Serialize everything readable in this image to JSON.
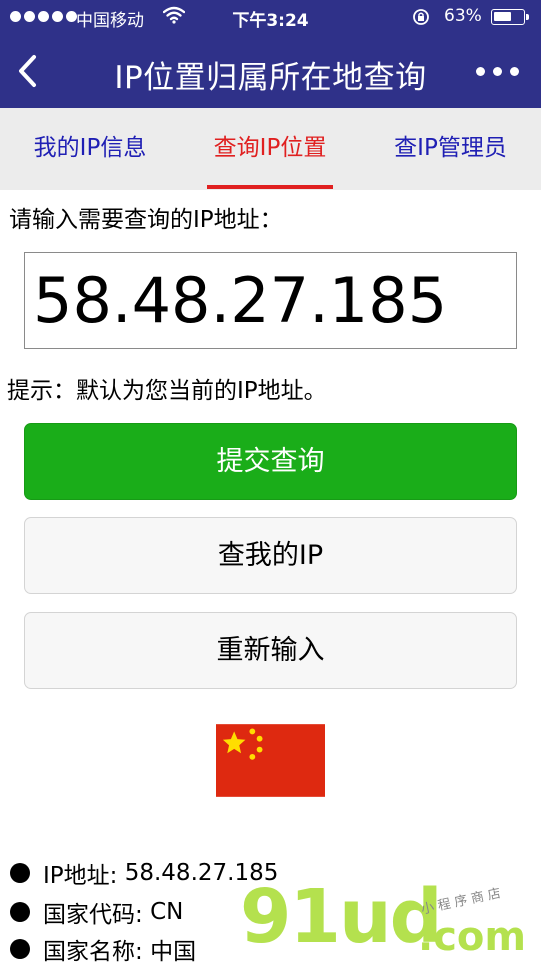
{
  "status_bar": {
    "carrier": "中国移动",
    "time": "下午3:24",
    "battery_text": "63%",
    "battery_level": 0.63
  },
  "header": {
    "title": "IP位置归属所在地查询",
    "icons": {
      "back": "chevron-left-icon",
      "more": "more-dots-icon"
    },
    "bg_color": "#2f3189"
  },
  "tabs": [
    {
      "label": "我的IP信息",
      "active": false
    },
    {
      "label": "查询IP位置",
      "active": true
    },
    {
      "label": "查IP管理员",
      "active": false
    }
  ],
  "form": {
    "prompt": "请输入需要查询的IP地址：",
    "ip_value": "58.48.27.185",
    "hint": "提示：默认为您当前的IP地址。"
  },
  "buttons": {
    "submit": "提交查询",
    "my_ip": "查我的IP",
    "reset": "重新输入"
  },
  "colors": {
    "accent_red": "#e02020",
    "tab_blue": "#1f1fb4",
    "submit_green": "#1aad19"
  },
  "flag": {
    "icon": "china-flag-icon"
  },
  "results": [
    {
      "label": "IP地址:",
      "value": "58.48.27.185"
    },
    {
      "label": "国家代码:",
      "value": "CN"
    },
    {
      "label": "国家名称:",
      "value": "中国"
    }
  ],
  "watermark": {
    "logo": "91ud",
    "suffix": ".com",
    "tagline": "小程序商店"
  }
}
